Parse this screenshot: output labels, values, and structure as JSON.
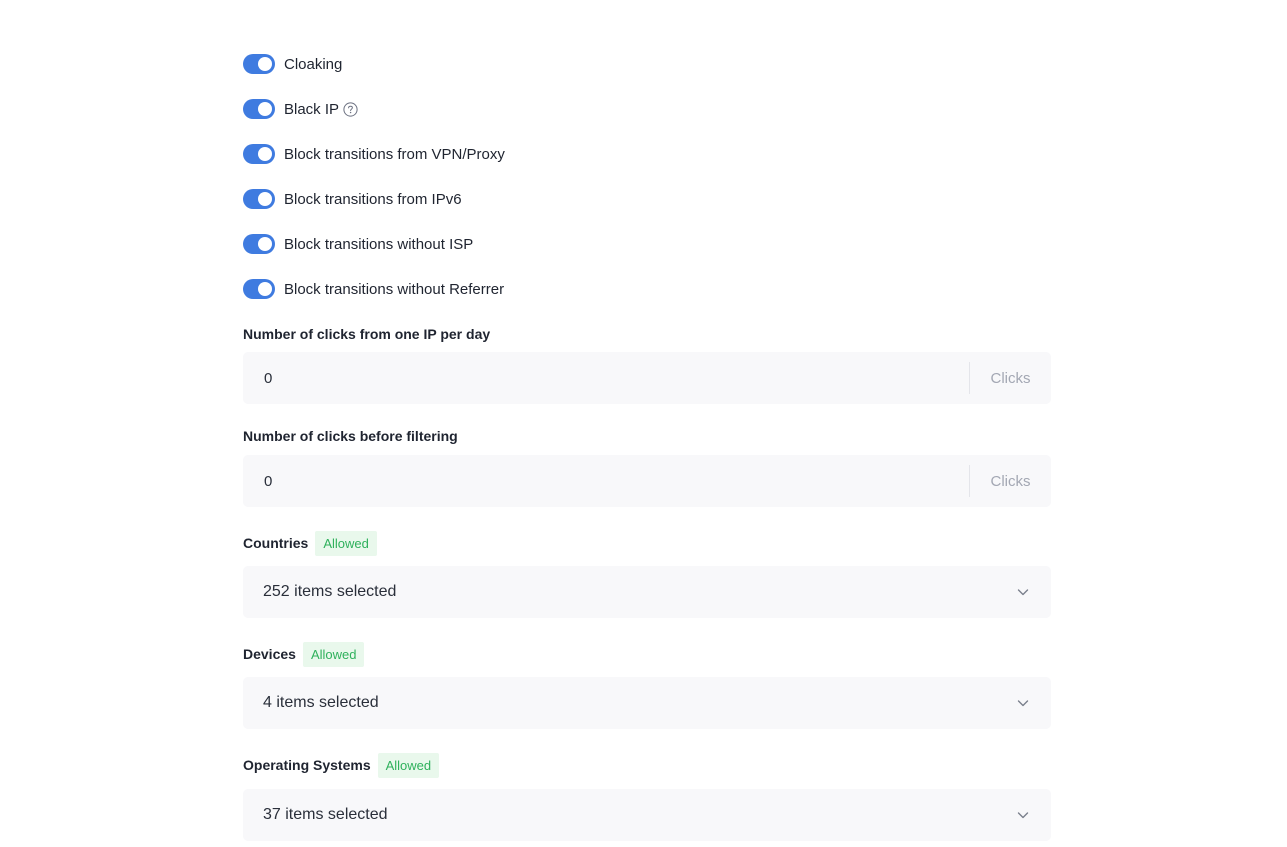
{
  "toggles": [
    {
      "label": "Cloaking",
      "on": true
    },
    {
      "label": "Black IP",
      "on": true,
      "help_icon": "question-circle-icon"
    },
    {
      "label": "Block transitions from VPN/Proxy",
      "on": true
    },
    {
      "label": "Block transitions from IPv6",
      "on": true
    },
    {
      "label": "Block transitions without ISP",
      "on": true
    },
    {
      "label": "Block transitions without Referrer",
      "on": true
    }
  ],
  "clicks_per_ip": {
    "label": "Number of clicks from one IP per day",
    "value": "0",
    "suffix": "Clicks"
  },
  "clicks_before_filtering": {
    "label": "Number of clicks before filtering",
    "value": "0",
    "suffix": "Clicks"
  },
  "countries": {
    "label": "Countries",
    "badge": "Allowed",
    "value": "252 items selected"
  },
  "devices": {
    "label": "Devices",
    "badge": "Allowed",
    "value": "4 items selected"
  },
  "operating_systems": {
    "label": "Operating Systems",
    "badge": "Allowed",
    "value": "37 items selected"
  },
  "colors": {
    "toggle_on": "#3f7be0",
    "badge_text": "#2fb15c",
    "badge_bg": "#e9f8ec",
    "field_bg": "#f8f8fa"
  }
}
